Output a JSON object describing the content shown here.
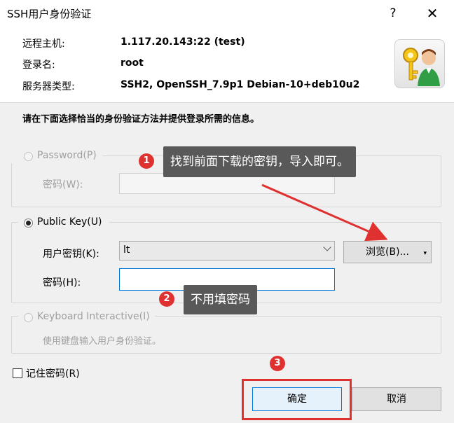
{
  "window": {
    "title": "SSH用户身份验证",
    "help": "?",
    "close": "✕"
  },
  "info": {
    "host_label": "远程主机:",
    "host_value": "1.117.20.143:22 (test)",
    "login_label": "登录名:",
    "login_value": "root",
    "server_label": "服务器类型:",
    "server_value": "SSH2, OpenSSH_7.9p1 Debian-10+deb10u2"
  },
  "instruction": "请在下面选择恰当的身份验证方法并提供登录所需的信息。",
  "password_group": {
    "radio_label": "Password(P)",
    "field_label": "密码(W):",
    "selected": false,
    "enabled": false
  },
  "publickey_group": {
    "radio_label": "Public Key(U)",
    "key_label": "用户密钥(K):",
    "key_value": "lt",
    "passphrase_label": "密码(H):",
    "passphrase_value": "",
    "browse_label": "浏览(B)...",
    "selected": true
  },
  "keyboard_group": {
    "radio_label": "Keyboard Interactive(I)",
    "description": "使用键盘输入用户身份验证。",
    "selected": false,
    "enabled": false
  },
  "remember": {
    "label": "记住密码(R)",
    "checked": false
  },
  "buttons": {
    "ok": "确定",
    "cancel": "取消"
  },
  "annotations": [
    {
      "number": "1",
      "text": "找到前面下载的密钥，导入即可。"
    },
    {
      "number": "2",
      "text": "不用填密码"
    },
    {
      "number": "3",
      "text": ""
    }
  ],
  "colors": {
    "annotation_red": "#e03131",
    "callout_bg": "#595959",
    "focus_blue": "#0078d7"
  }
}
